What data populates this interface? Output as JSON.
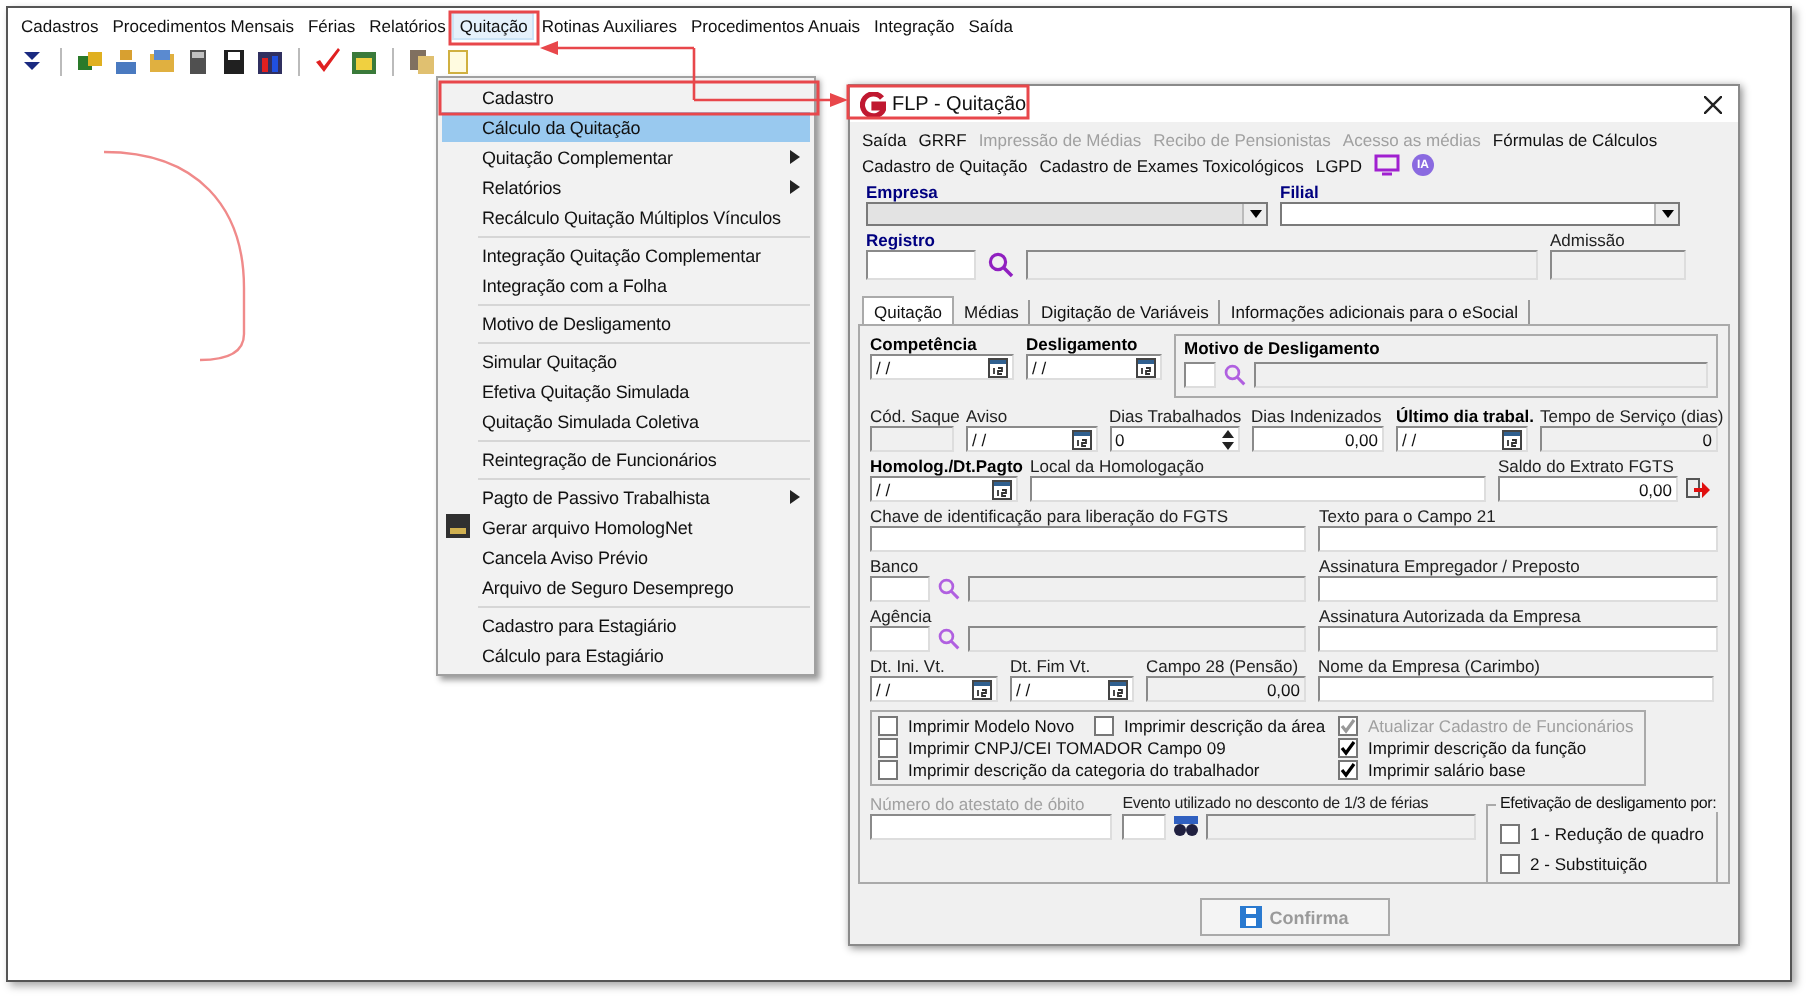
{
  "menu_bar": [
    {
      "label": "Cadastros",
      "selected": false
    },
    {
      "label": "Procedimentos Mensais",
      "selected": false
    },
    {
      "label": "Férias",
      "selected": false
    },
    {
      "label": "Relatórios",
      "selected": false
    },
    {
      "label": "Quitação",
      "selected": true
    },
    {
      "label": "Rotinas Auxiliares",
      "selected": false
    },
    {
      "label": "Procedimentos Anuais",
      "selected": false
    },
    {
      "label": "Integração",
      "selected": false
    },
    {
      "label": "Saída",
      "selected": false
    }
  ],
  "dropdown": {
    "groups": [
      [
        {
          "label": "Cadastro",
          "selected": false,
          "submenu": false,
          "icon": false
        },
        {
          "label": "Cálculo da Quitação",
          "selected": true,
          "submenu": false,
          "icon": false
        },
        {
          "label": "Quitação Complementar",
          "selected": false,
          "submenu": true,
          "icon": false
        },
        {
          "label": "Relatórios",
          "selected": false,
          "submenu": true,
          "icon": false
        },
        {
          "label": "Recálculo Quitação Múltiplos Vínculos",
          "selected": false,
          "submenu": false,
          "icon": false
        }
      ],
      [
        {
          "label": "Integração Quitação Complementar",
          "selected": false,
          "submenu": false,
          "icon": false
        },
        {
          "label": "Integração com a Folha",
          "selected": false,
          "submenu": false,
          "icon": false
        }
      ],
      [
        {
          "label": "Motivo de Desligamento",
          "selected": false,
          "submenu": false,
          "icon": false
        }
      ],
      [
        {
          "label": "Simular Quitação",
          "selected": false,
          "submenu": false,
          "icon": false
        },
        {
          "label": "Efetiva Quitação Simulada",
          "selected": false,
          "submenu": false,
          "icon": false
        },
        {
          "label": "Quitação Simulada Coletiva",
          "selected": false,
          "submenu": false,
          "icon": false
        }
      ],
      [
        {
          "label": "Reintegração de Funcionários",
          "selected": false,
          "submenu": false,
          "icon": false
        }
      ],
      [
        {
          "label": "Pagto de Passivo Trabalhista",
          "selected": false,
          "submenu": true,
          "icon": false
        },
        {
          "label": "Gerar arquivo HomologNet",
          "selected": false,
          "submenu": false,
          "icon": true
        },
        {
          "label": "Cancela Aviso Prévio",
          "selected": false,
          "submenu": false,
          "icon": false
        },
        {
          "label": "Arquivo de Seguro Desemprego",
          "selected": false,
          "submenu": false,
          "icon": false
        }
      ],
      [
        {
          "label": "Cadastro para Estagiário",
          "selected": false,
          "submenu": false,
          "icon": false
        },
        {
          "label": "Cálculo para Estagiário",
          "selected": false,
          "submenu": false,
          "icon": false
        }
      ]
    ]
  },
  "dialog": {
    "title": "FLP - Quitação",
    "menu_rows": [
      [
        {
          "label": "Saída",
          "disabled": false
        },
        {
          "label": "GRRF",
          "disabled": false
        },
        {
          "label": "Impressão de Médias",
          "disabled": true
        },
        {
          "label": "Recibo de Pensionistas",
          "disabled": true
        },
        {
          "label": "Acesso as médias",
          "disabled": true
        },
        {
          "label": "Fórmulas de Cálculos",
          "disabled": false
        }
      ],
      [
        {
          "label": "Cadastro de Quitação",
          "disabled": false
        },
        {
          "label": "Cadastro de Exames Toxicológicos",
          "disabled": false
        },
        {
          "label": "LGPD",
          "disabled": false
        }
      ]
    ],
    "ia_badge": "IA",
    "empresa": {
      "label": "Empresa",
      "disabled": true
    },
    "filial": {
      "label": "Filial",
      "disabled": false
    },
    "registro": {
      "label": "Registro"
    },
    "admissao": {
      "label": "Admissão"
    },
    "tabs": [
      {
        "label": "Quitação",
        "selected": true
      },
      {
        "label": "Médias",
        "selected": false
      },
      {
        "label": "Digitação de Variáveis",
        "selected": false
      },
      {
        "label": "Informações adicionais para o eSocial",
        "selected": false
      }
    ],
    "form_rows": [
      [
        {
          "label": "Competência",
          "kind": "date",
          "bold": true,
          "value": "/ /"
        },
        {
          "label": "Desligamento",
          "kind": "date",
          "bold": true,
          "value": "/ /"
        },
        {
          "label": "Motivo de Desligamento",
          "kind": "group_lookup",
          "bold": true
        }
      ],
      [
        {
          "label": "Cód. Saque",
          "kind": "readonly",
          "bold": false
        },
        {
          "label": "Aviso",
          "kind": "date",
          "bold": false,
          "value": "/ /"
        },
        {
          "label": "Dias Trabalhados",
          "kind": "spin",
          "bold": false,
          "value": "0"
        },
        {
          "label": "Dias Indenizados",
          "kind": "number",
          "bold": false,
          "value": "0,00"
        },
        {
          "label": "Último dia trabal.",
          "kind": "date",
          "bold": true,
          "value": "/ /"
        },
        {
          "label": "Tempo de Serviço (dias)",
          "kind": "readonly",
          "bold": false,
          "value": "0"
        }
      ],
      [
        {
          "label": "Homolog./Dt.Pagto",
          "kind": "date",
          "bold": true,
          "value": "/ /"
        },
        {
          "label": "Local da Homologação",
          "kind": "text",
          "bold": false
        },
        {
          "label": "Saldo do Extrato FGTS",
          "kind": "number",
          "bold": false,
          "value": "0,00"
        }
      ],
      [
        {
          "label": "Chave de identificação para liberação do FGTS",
          "kind": "text",
          "bold": false
        },
        {
          "label": "Texto para o Campo 21",
          "kind": "text",
          "bold": false
        }
      ],
      [
        {
          "label": "Banco",
          "kind": "lookup",
          "bold": false
        },
        {
          "label": "Assinatura Empregador / Preposto",
          "kind": "text",
          "bold": false
        }
      ],
      [
        {
          "label": "Agência",
          "kind": "lookup",
          "bold": false
        },
        {
          "label": "Assinatura Autorizada da Empresa",
          "kind": "text",
          "bold": false
        }
      ],
      [
        {
          "label": "Dt. Ini. Vt.",
          "kind": "date",
          "bold": false,
          "value": "/ /"
        },
        {
          "label": "Dt. Fim Vt.",
          "kind": "date",
          "bold": false,
          "value": "/ /"
        },
        {
          "label": "Campo 28 (Pensão)",
          "kind": "readonly",
          "bold": false,
          "value": "0,00"
        },
        {
          "label": "Nome da Empresa (Carimbo)",
          "kind": "text",
          "bold": false
        }
      ]
    ],
    "checkboxes": [
      {
        "label": "Imprimir Modelo Novo",
        "checked": false,
        "disabled": false
      },
      {
        "label": "Imprimir descrição da área",
        "checked": false,
        "disabled": false
      },
      {
        "label": "Atualizar Cadastro de Funcionários",
        "checked": true,
        "disabled": true
      },
      {
        "label": "Imprimir CNPJ/CEI TOMADOR Campo 09",
        "checked": false,
        "disabled": false
      },
      {
        "label": "Imprimir descrição da função",
        "checked": true,
        "disabled": false
      },
      {
        "label": "Imprimir descrição da categoria do trabalhador",
        "checked": false,
        "disabled": false
      },
      {
        "label": "Imprimir salário base",
        "checked": true,
        "disabled": false
      }
    ],
    "obito": {
      "label": "Número do atestato de óbito",
      "disabled": true
    },
    "evento": {
      "label": "Evento utilizado no desconto de 1/3 de férias"
    },
    "efetivacao": {
      "title": "Efetivação de desligamento por:",
      "options": [
        {
          "label": "1 - Redução de quadro",
          "checked": false
        },
        {
          "label": "2 - Substituição",
          "checked": false
        }
      ]
    },
    "confirm": {
      "label": "Confirma",
      "disabled": true
    }
  }
}
